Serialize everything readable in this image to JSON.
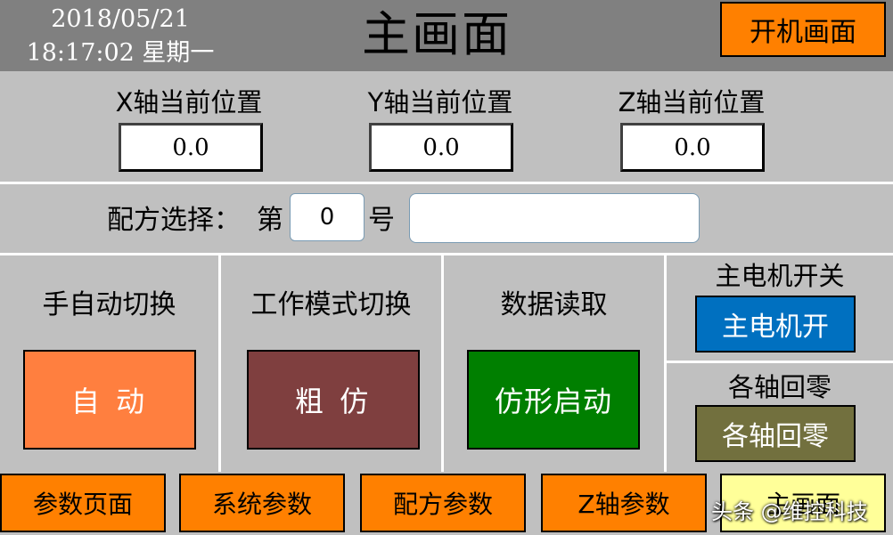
{
  "header": {
    "date": "2018/05/21",
    "time": "18:17:02 星期一",
    "title": "主画面",
    "start_screen_label": "开机画面"
  },
  "positions": [
    {
      "label": "X轴当前位置",
      "value": "0.0"
    },
    {
      "label": "Y轴当前位置",
      "value": "0.0"
    },
    {
      "label": "Z轴当前位置",
      "value": "0.0"
    }
  ],
  "recipe": {
    "label": "配方选择：",
    "prefix": "第",
    "number": "0",
    "suffix": "号",
    "name": ""
  },
  "panels": {
    "manual_auto": {
      "title": "手自动切换",
      "button": "自 动"
    },
    "work_mode": {
      "title": "工作模式切换",
      "button": "粗 仿"
    },
    "data_read": {
      "title": "数据读取",
      "button": "仿形启动"
    },
    "main_motor": {
      "title": "主电机开关",
      "button": "主电机开"
    },
    "homing": {
      "title": "各轴回零",
      "button": "各轴回零"
    }
  },
  "nav": [
    {
      "label": "参数页面"
    },
    {
      "label": "系统参数"
    },
    {
      "label": "配方参数"
    },
    {
      "label": "Z轴参数"
    },
    {
      "label": "主画面"
    }
  ],
  "watermark": "头条 @维控科技",
  "colors": {
    "header_bg": "#808080",
    "body_bg": "#c0c0c0",
    "orange": "#ff8000",
    "auto_btn": "#ff7f3f",
    "mode_btn": "#7f3f3f",
    "start_btn": "#007f00",
    "motor_btn": "#0070c0",
    "home_btn": "#72703e",
    "active_nav": "#ffff99"
  }
}
